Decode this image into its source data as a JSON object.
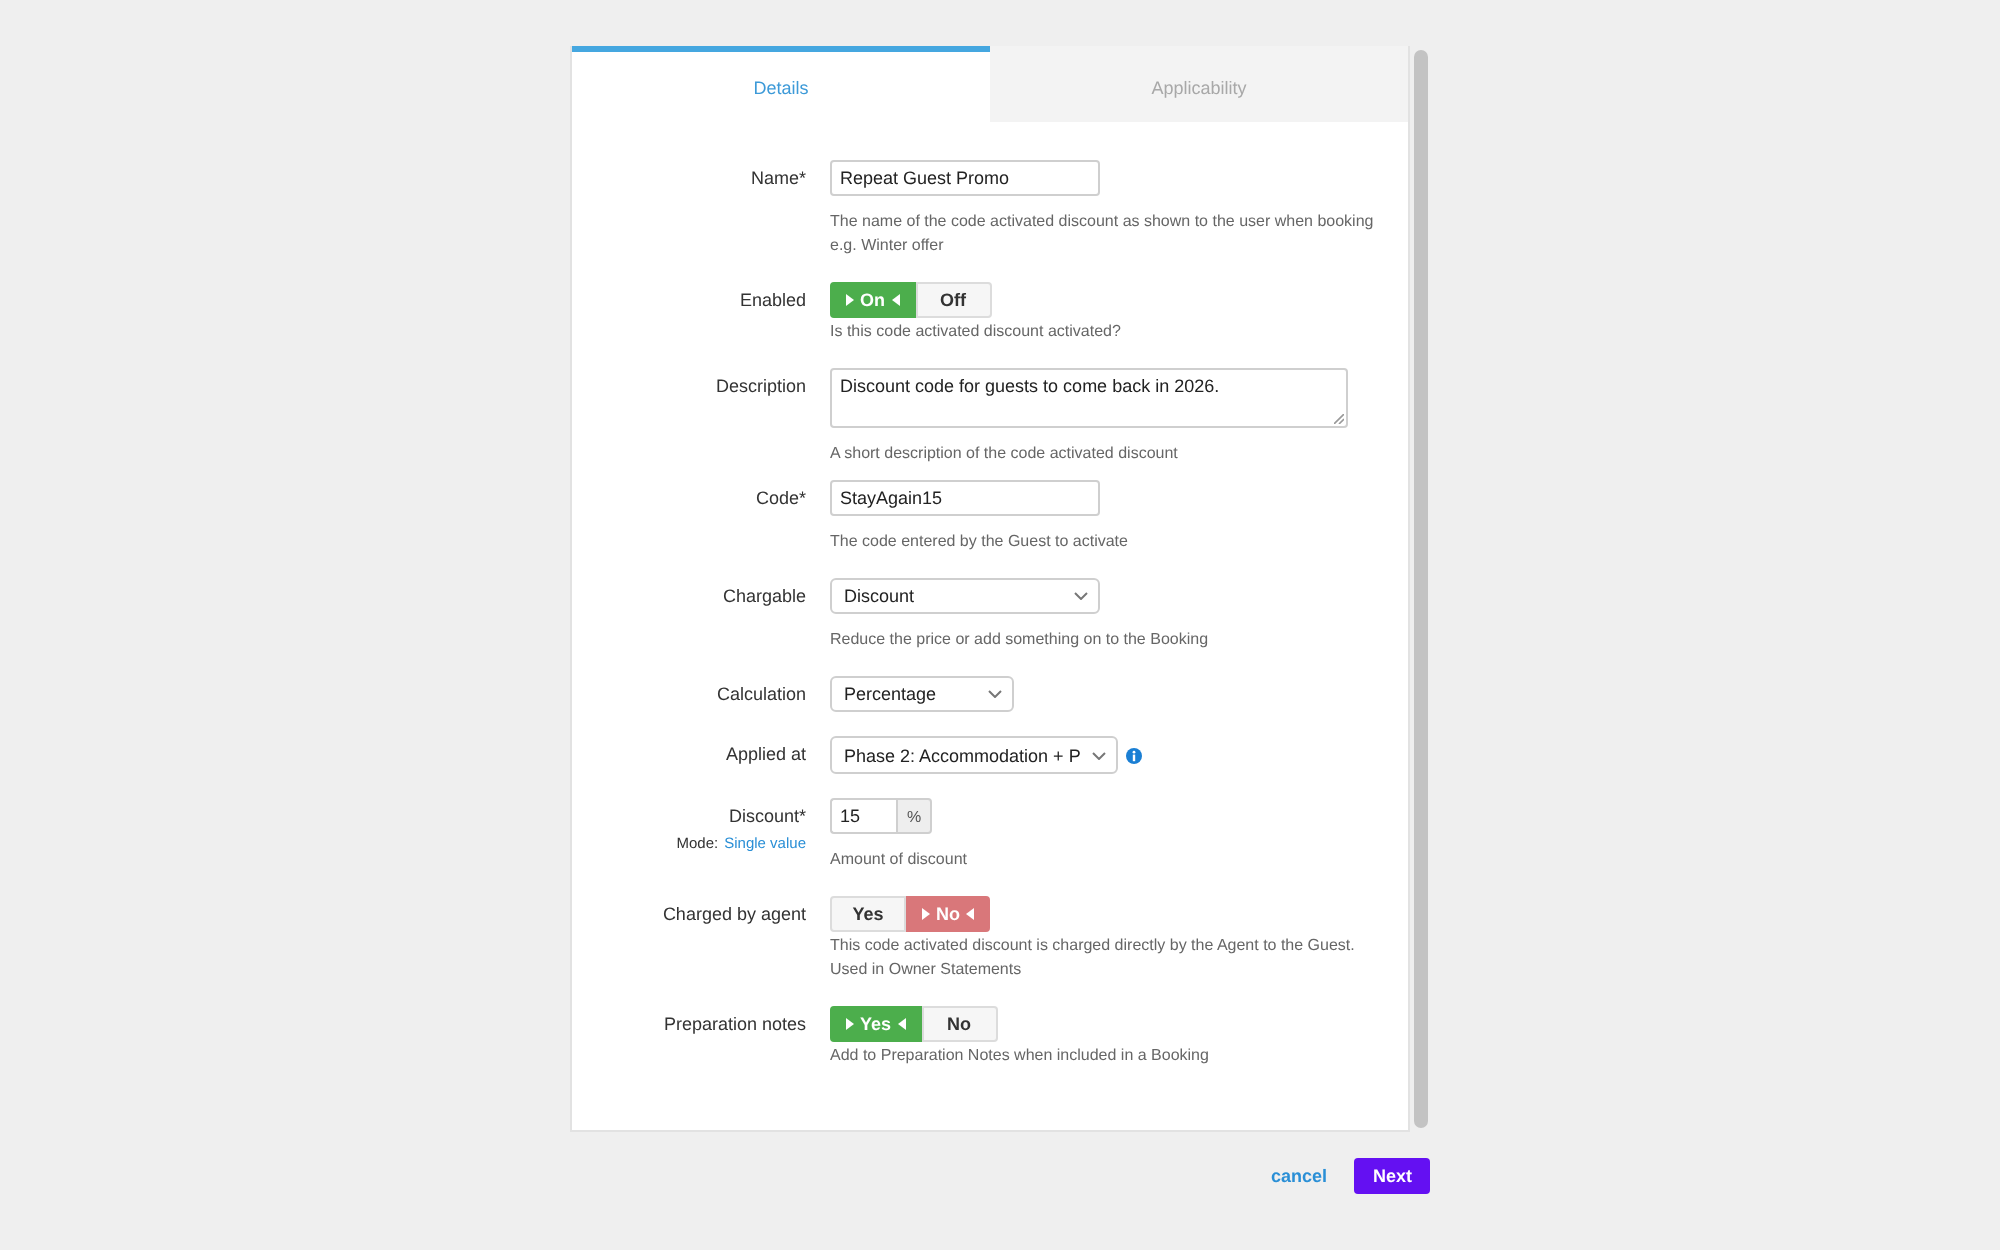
{
  "tabs": [
    {
      "label": "Details",
      "selected": true
    },
    {
      "label": "Applicability",
      "selected": false
    }
  ],
  "fields": [
    {
      "kind": "text",
      "label": "Name*",
      "value": "Repeat Guest Promo",
      "hint": [
        "The name of the code activated discount as shown to the user when booking",
        "e.g. Winter offer"
      ]
    },
    {
      "kind": "toggle",
      "label": "Enabled",
      "color": "#4cae4c",
      "options": [
        {
          "label": "On",
          "selected": true
        },
        {
          "label": "Off",
          "selected": false
        }
      ],
      "hint": [
        "Is this code activated discount activated?"
      ]
    },
    {
      "kind": "textarea",
      "label": "Description",
      "value": "Discount code for guests to come back in 2026.",
      "hint": [
        "A short description of the code activated discount"
      ]
    },
    {
      "kind": "text",
      "label": "Code*",
      "value": "StayAgain15",
      "hint": [
        "The code entered by the Guest to activate"
      ]
    },
    {
      "kind": "select",
      "label": "Chargable",
      "value": "Discount",
      "hint": [
        "Reduce the price or add something on to the Booking"
      ]
    },
    {
      "kind": "select",
      "label": "Calculation",
      "value": "Percentage"
    },
    {
      "kind": "select",
      "label": "Applied at",
      "value": "Phase 2: Accommodation + P",
      "info_icon": true
    },
    {
      "kind": "number",
      "label": "Discount*",
      "value": "15",
      "unit": "%",
      "mode": {
        "label": "Mode:",
        "value": "Single value"
      },
      "hint": [
        "Amount of discount"
      ]
    },
    {
      "kind": "toggle",
      "label": "Charged by agent",
      "color": "#d9777a",
      "options": [
        {
          "label": "Yes",
          "selected": false
        },
        {
          "label": "No",
          "selected": true
        }
      ],
      "hint": [
        "This code activated discount is charged directly by the Agent to the Guest.",
        "Used in Owner Statements"
      ]
    },
    {
      "kind": "toggle",
      "label": "Preparation notes",
      "color": "#4cae4c",
      "options": [
        {
          "label": "Yes",
          "selected": true
        },
        {
          "label": "No",
          "selected": false
        }
      ],
      "hint": [
        "Add to Preparation Notes when included in a Booking"
      ]
    }
  ],
  "footer": {
    "cancel": "cancel",
    "next": "Next"
  }
}
